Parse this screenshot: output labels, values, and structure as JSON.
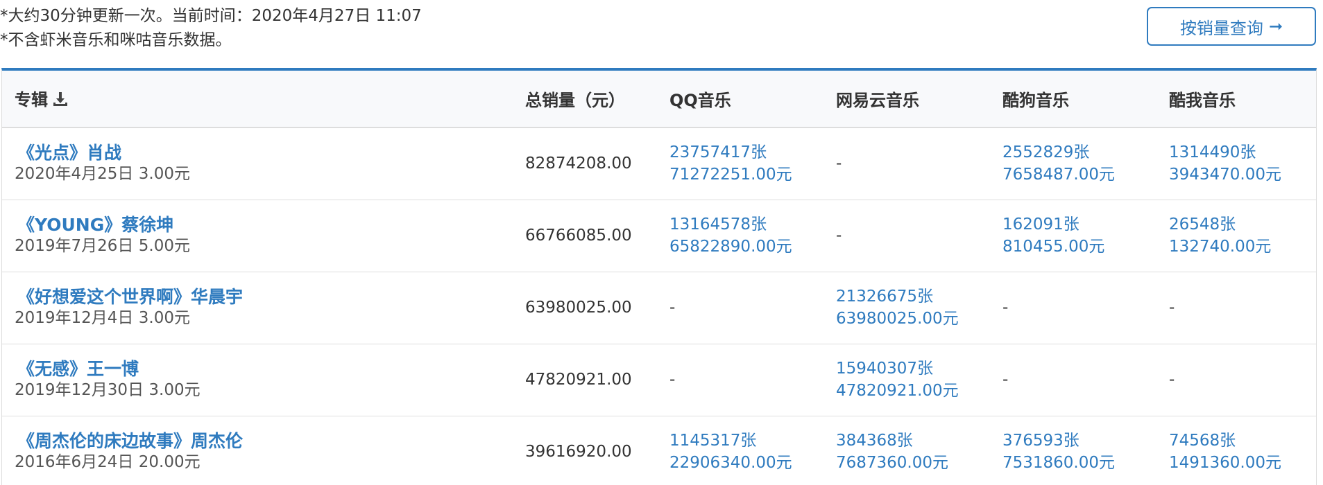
{
  "notes": {
    "line1": "*大约30分钟更新一次。当前时间：2020年4月27日 11:07",
    "line2": "*不含虾米音乐和咪咕音乐数据。"
  },
  "query_button": {
    "label": "按销量查询",
    "icon": "arrow-right-icon"
  },
  "table": {
    "headers": {
      "album": "专辑",
      "total": "总销量（元）",
      "qq": "QQ音乐",
      "netease": "网易云音乐",
      "kugou": "酷狗音乐",
      "kuwo": "酷我音乐"
    },
    "rows": [
      {
        "title": "《光点》肖战",
        "meta": "2020年4月25日  3.00元",
        "total": "82874208.00",
        "qq": {
          "units": "23757417张",
          "amount": "71272251.00元"
        },
        "netease": {
          "text": "-"
        },
        "kugou": {
          "units": "2552829张",
          "amount": "7658487.00元"
        },
        "kuwo": {
          "units": "1314490张",
          "amount": "3943470.00元"
        }
      },
      {
        "title": "《YOUNG》蔡徐坤",
        "meta": "2019年7月26日  5.00元",
        "total": "66766085.00",
        "qq": {
          "units": "13164578张",
          "amount": "65822890.00元"
        },
        "netease": {
          "text": "-"
        },
        "kugou": {
          "units": "162091张",
          "amount": "810455.00元"
        },
        "kuwo": {
          "units": "26548张",
          "amount": "132740.00元"
        }
      },
      {
        "title": "《好想爱这个世界啊》华晨宇",
        "meta": "2019年12月4日  3.00元",
        "total": "63980025.00",
        "qq": {
          "text": "-"
        },
        "netease": {
          "units": "21326675张",
          "amount": "63980025.00元"
        },
        "kugou": {
          "text": "-"
        },
        "kuwo": {
          "text": "-"
        }
      },
      {
        "title": "《无感》王一博",
        "meta": "2019年12月30日  3.00元",
        "total": "47820921.00",
        "qq": {
          "text": "-"
        },
        "netease": {
          "units": "15940307张",
          "amount": "47820921.00元"
        },
        "kugou": {
          "text": "-"
        },
        "kuwo": {
          "text": "-"
        }
      },
      {
        "title": "《周杰伦的床边故事》周杰伦",
        "meta": "2016年6月24日  20.00元",
        "total": "39616920.00",
        "qq": {
          "units": "1145317张",
          "amount": "22906340.00元"
        },
        "netease": {
          "units": "384368张",
          "amount": "7687360.00元"
        },
        "kugou": {
          "units": "376593张",
          "amount": "7531860.00元"
        },
        "kuwo": {
          "units": "74568张",
          "amount": "1491360.00元"
        }
      }
    ]
  },
  "colors": {
    "accent": "#2f7bbf",
    "header_bg": "#f8f9fb",
    "border": "#dddddd"
  }
}
